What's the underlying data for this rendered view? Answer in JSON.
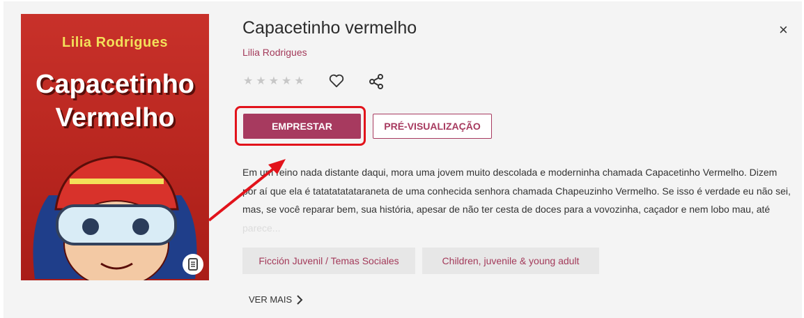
{
  "book": {
    "title": "Capacetinho vermelho",
    "author": "Lilia Rodrigues",
    "rating_stars": "★★★★★",
    "close_symbol": "×"
  },
  "cover": {
    "author": "Lilia Rodrigues",
    "title_line1": "Capacetinho",
    "title_line2": "Vermelho"
  },
  "actions": {
    "borrow_label": "EMPRESTAR",
    "preview_label": "PRÉ-VISUALIZAÇÃO"
  },
  "description": {
    "main": "Em um reino nada distante daqui, mora uma jovem muito descolada e moderninha chamada Capacetinho Vermelho. Dizem por aí que ela é tatatatatataraneta de uma conhecida senhora chamada Chapeuzinho Vermelho. Se isso é verdade eu não sei, mas, se você reparar bem, sua história, apesar de não ter cesta de doces para a vovozinha, caçador e nem lobo mau, até ",
    "faded": "parece..."
  },
  "tags": [
    "Ficción Juvenil / Temas Sociales",
    "Children, juvenile & young adult"
  ],
  "more_label": "VER MAIS",
  "colors": {
    "accent": "#a73a5f",
    "highlight": "#e2131b"
  },
  "icons": {
    "heart": "heart-icon",
    "share": "share-icon",
    "close": "close-icon",
    "chevron": "chevron-right-icon",
    "document": "document-icon"
  }
}
